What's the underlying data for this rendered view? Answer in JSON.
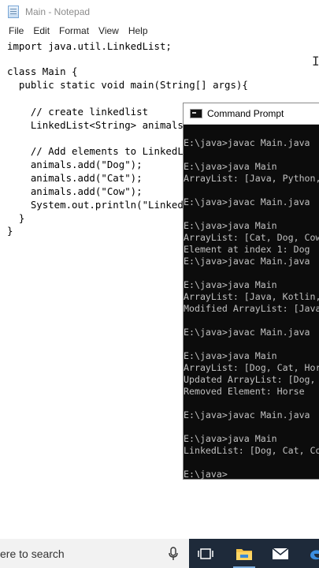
{
  "notepad": {
    "title": "Main - Notepad",
    "menu": [
      "File",
      "Edit",
      "Format",
      "View",
      "Help"
    ],
    "code_lines": [
      "import java.util.LinkedList;",
      "",
      "class Main {",
      "  public static void main(String[] args){",
      "",
      "    // create linkedlist",
      "    LinkedList<String> animals = new LinkedList<>();",
      "",
      "    // Add elements to LinkedList",
      "    animals.add(\"Dog\");",
      "    animals.add(\"Cat\");",
      "    animals.add(\"Cow\");",
      "    System.out.println(\"LinkedList: \" + animals);",
      "  }",
      "}"
    ]
  },
  "cmd": {
    "title": "Command Prompt",
    "lines": [
      "",
      "E:\\java>javac Main.java",
      "",
      "E:\\java>java Main",
      "ArrayList: [Java, Python, Swift]",
      "",
      "E:\\java>javac Main.java",
      "",
      "E:\\java>java Main",
      "ArrayList: [Cat, Dog, Cow]",
      "Element at index 1: Dog",
      "E:\\java>javac Main.java",
      "",
      "E:\\java>java Main",
      "ArrayList: [Java, Kotlin, C++]",
      "Modified ArrayList: [Java, Kotlin]",
      "",
      "E:\\java>javac Main.java",
      "",
      "E:\\java>java Main",
      "ArrayList: [Dog, Cat, Horse]",
      "Updated ArrayList: [Dog, Cat]",
      "Removed Element: Horse",
      "",
      "E:\\java>javac Main.java",
      "",
      "E:\\java>java Main",
      "LinkedList: [Dog, Cat, Cow]",
      "",
      "E:\\java>"
    ]
  },
  "taskbar": {
    "search_text": "ere to search",
    "icons": [
      "microphone-icon",
      "task-view-icon",
      "file-explorer-icon",
      "mail-icon",
      "edge-icon"
    ],
    "colors": {
      "taskbar": "#1e2a3a",
      "cmd_text": "#c0c0c0",
      "cmd_bg": "#0c0c0c"
    }
  }
}
